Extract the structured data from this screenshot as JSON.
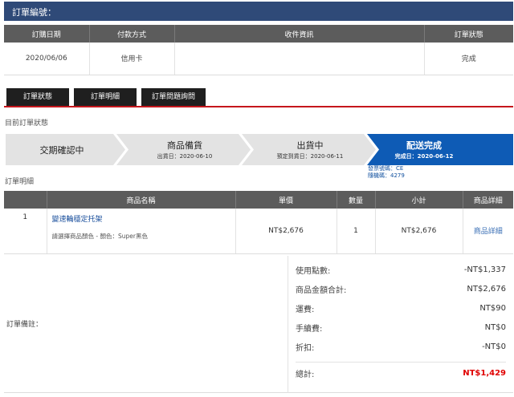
{
  "order": {
    "title": "訂單編號："
  },
  "info_table": {
    "headers": [
      "訂購日期",
      "付款方式",
      "收件資訊",
      "訂單狀態"
    ],
    "row": {
      "date": "2020/06/06",
      "payment": "信用卡",
      "recipient": "",
      "status": "完成"
    }
  },
  "tabs": [
    {
      "label": "訂單狀態"
    },
    {
      "label": "訂單明細"
    },
    {
      "label": "訂單問題詢問"
    }
  ],
  "status_section": {
    "label": "目前訂單狀態"
  },
  "progress": {
    "active_color": "#0e5bb5",
    "inactive_color": "#e3e3e3",
    "steps": [
      {
        "title": "交期確認中",
        "date": ""
      },
      {
        "title": "商品備貨",
        "date": "出貨日：2020-06-10"
      },
      {
        "title": "出貨中",
        "date": "預定到貨日：2020-06-11"
      },
      {
        "title": "配送完成",
        "date": "完成日：2020-06-12"
      }
    ]
  },
  "invoice": {
    "number_line": "發票號碼：CE",
    "random_line": "隨機碼：4279"
  },
  "detail_section": {
    "label": "訂單明細"
  },
  "detail_table": {
    "headers": [
      "",
      "商品名稱",
      "單價",
      "數量",
      "小計",
      "商品詳細"
    ],
    "items": [
      {
        "index": "1",
        "name": "變速輪穩定托架",
        "option": "請選擇商品顏色 - 顏色：Super黑色",
        "price": "NT$2,676",
        "qty": "1",
        "subtotal": "NT$2,676",
        "detail_link": "商品詳細"
      }
    ]
  },
  "remark": {
    "label": "訂單備註："
  },
  "summary": {
    "points_label": "使用點數:",
    "points_value": "-NT$1,337",
    "amount_label": "商品金額合計:",
    "amount_value": "NT$2,676",
    "shipping_label": "運費:",
    "shipping_value": "NT$90",
    "fee_label": "手續費:",
    "fee_value": "NT$0",
    "discount_label": "折扣:",
    "discount_value": "-NT$0",
    "total_label": "總計:",
    "total_value": "NT$1,429",
    "total_color": "#e00000"
  }
}
